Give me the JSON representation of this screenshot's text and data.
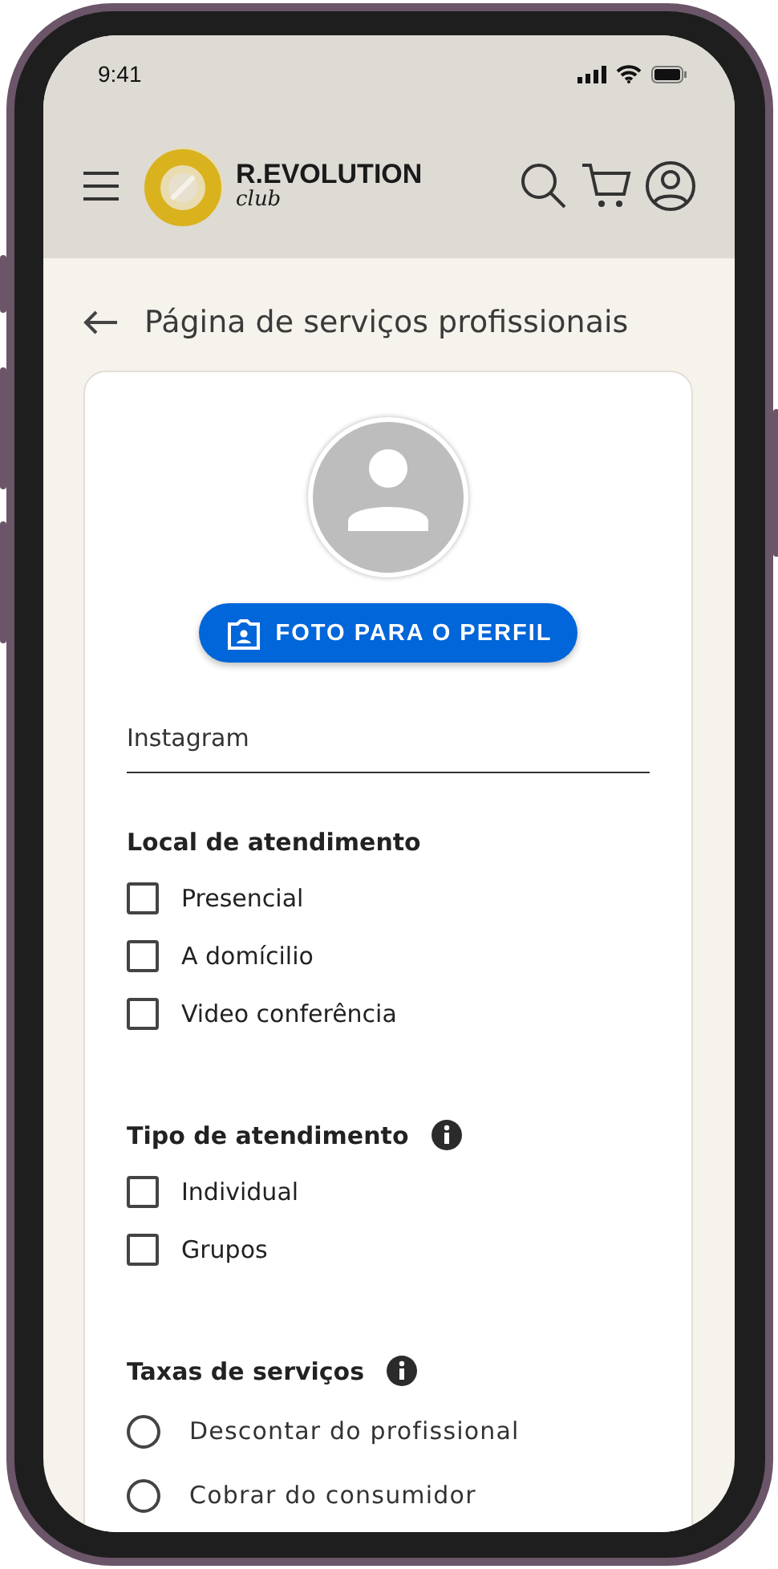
{
  "status_bar": {
    "time": "9:41"
  },
  "header": {
    "brand": "R.EVOLUTION",
    "brand_sub": "club"
  },
  "page": {
    "title": "Página de serviços profissionais"
  },
  "profile": {
    "button": "FOTO PARA O PERFIL"
  },
  "instagram": {
    "placeholder": "Instagram"
  },
  "sections": [
    {
      "title": "Local de atendimento",
      "info": false,
      "options": [
        {
          "kind": "checkbox",
          "label": "Presencial",
          "checked": false
        },
        {
          "kind": "checkbox",
          "label": "A domícilio",
          "checked": false
        },
        {
          "kind": "checkbox",
          "label": "Video conferência",
          "checked": false
        }
      ]
    },
    {
      "title": "Tipo de atendimento",
      "info": true,
      "options": [
        {
          "kind": "checkbox",
          "label": "Individual",
          "checked": false
        },
        {
          "kind": "checkbox",
          "label": "Grupos",
          "checked": false
        }
      ]
    },
    {
      "title": "Taxas de serviços",
      "info": true,
      "options": [
        {
          "kind": "radio",
          "label": "Descontar do profissional",
          "selected": false
        },
        {
          "kind": "radio",
          "label": "Cobrar do consumidor",
          "selected": false
        }
      ]
    }
  ]
}
